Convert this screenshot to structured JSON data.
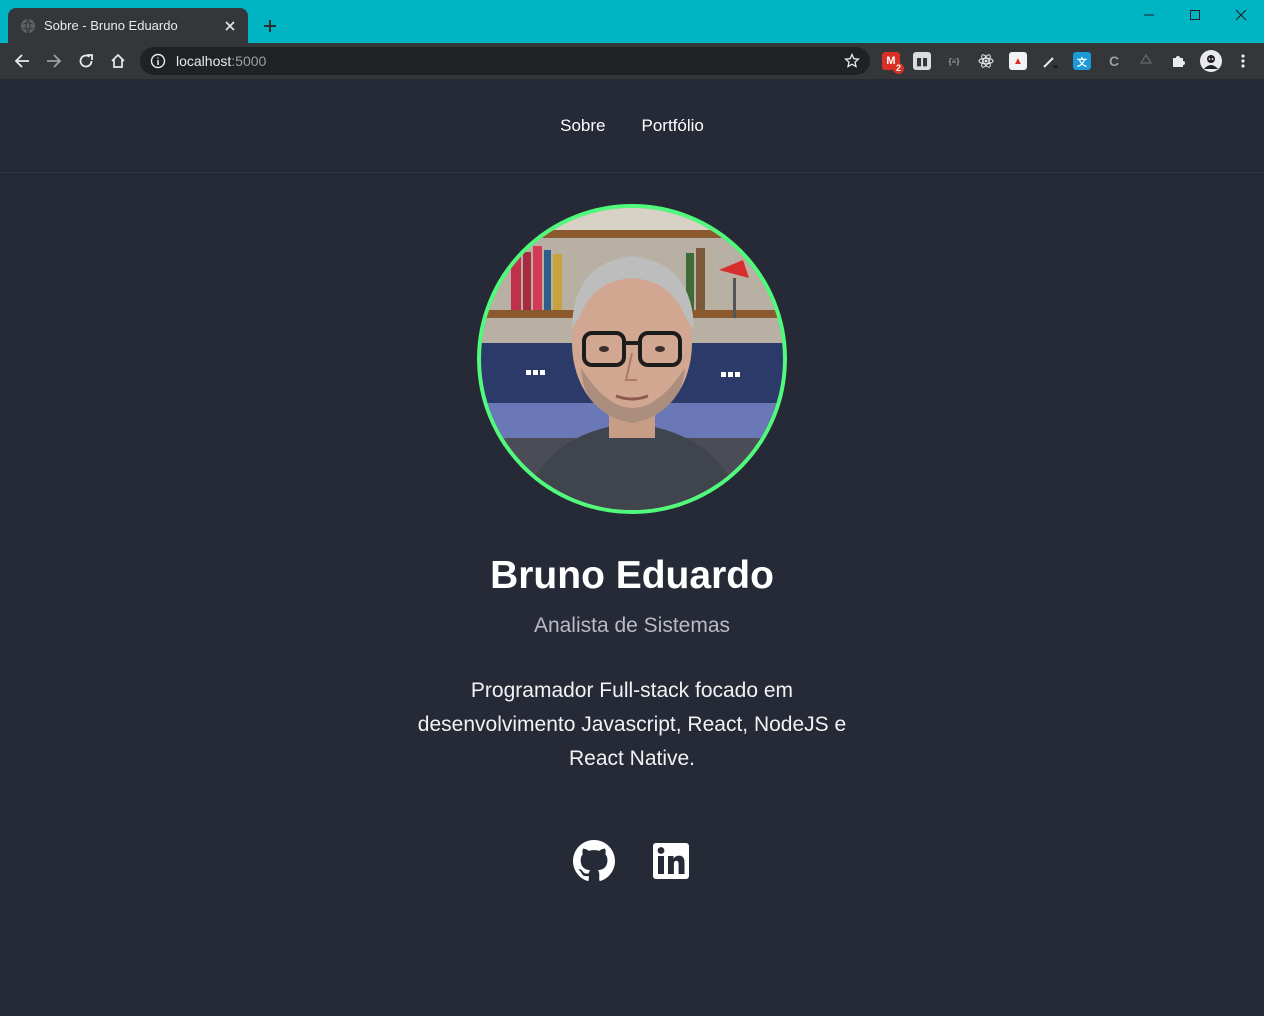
{
  "browser": {
    "tab_title": "Sobre - Bruno Eduardo",
    "url_host": "localhost",
    "url_port": ":5000",
    "extensions": [
      {
        "name": "gmail-extension-icon",
        "badge": "2"
      },
      {
        "name": "trello-extension-icon"
      },
      {
        "name": "json-viewer-extension-icon",
        "text": "{≡}"
      },
      {
        "name": "react-devtools-icon"
      },
      {
        "name": "colorzilla-extension-icon"
      },
      {
        "name": "eyedropper-extension-icon"
      },
      {
        "name": "translate-extension-icon"
      },
      {
        "name": "css-extension-icon"
      },
      {
        "name": "recycle-extension-icon"
      },
      {
        "name": "extensions-puzzle-icon"
      },
      {
        "name": "profile-avatar-icon"
      }
    ]
  },
  "nav": {
    "about_label": "Sobre",
    "portfolio_label": "Portfólio"
  },
  "profile": {
    "name": "Bruno Eduardo",
    "role": "Analista de Sistemas",
    "bio": "Programador Full-stack focado em desenvolvimento Javascript, React, NodeJS e React Native."
  },
  "social": {
    "github_icon": "github-icon",
    "linkedin_icon": "linkedin-icon"
  },
  "colors": {
    "page_bg": "#262a36",
    "accent_ring": "#50fa7b",
    "titlebar": "#00b4c3"
  }
}
